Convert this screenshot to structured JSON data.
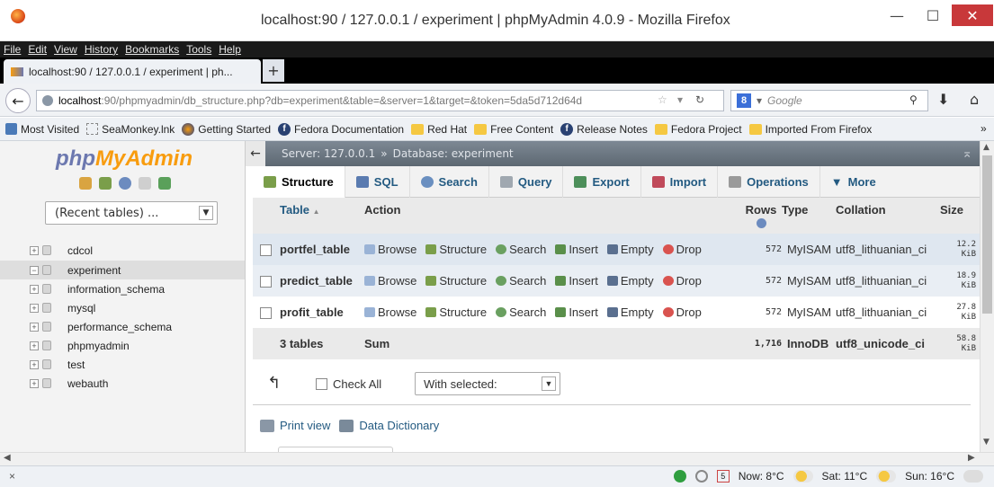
{
  "window": {
    "title": "localhost:90 / 127.0.0.1 / experiment | phpMyAdmin 4.0.9 - Mozilla Firefox"
  },
  "menu": [
    "File",
    "Edit",
    "View",
    "History",
    "Bookmarks",
    "Tools",
    "Help"
  ],
  "tab": {
    "title": "localhost:90 / 127.0.0.1 / experiment | ph...",
    "new_tab": "+"
  },
  "nav": {
    "url_host": "localhost",
    "url_rest": ":90/phpmyadmin/db_structure.php?db=experiment&table=&server=1&target=&token=5da5d712d64d",
    "search_placeholder": "Google",
    "search_engine_icon": "8"
  },
  "bookmarks": [
    "Most Visited",
    "SeaMonkey.lnk",
    "Getting Started",
    "Fedora Documentation",
    "Red Hat",
    "Free Content",
    "Release Notes",
    "Fedora Project",
    "Imported From Firefox"
  ],
  "bookmarks_overflow": "»",
  "sidebar": {
    "logo_a": "php",
    "logo_b": "MyAdmin",
    "recent": "(Recent tables) ...",
    "databases": [
      {
        "name": "cdcol",
        "exp": "+"
      },
      {
        "name": "experiment",
        "exp": "−"
      },
      {
        "name": "information_schema",
        "exp": "+"
      },
      {
        "name": "mysql",
        "exp": "+"
      },
      {
        "name": "performance_schema",
        "exp": "+"
      },
      {
        "name": "phpmyadmin",
        "exp": "+"
      },
      {
        "name": "test",
        "exp": "+"
      },
      {
        "name": "webauth",
        "exp": "+"
      }
    ]
  },
  "breadcrumb": {
    "server": "Server: 127.0.0.1",
    "sep": "»",
    "database": "Database: experiment"
  },
  "tabs": [
    {
      "label": "Structure",
      "color": "#7a9e4a"
    },
    {
      "label": "SQL",
      "color": "#5a7bb0"
    },
    {
      "label": "Search",
      "color": "#6a8fc0"
    },
    {
      "label": "Query",
      "color": "#a0a8b0"
    },
    {
      "label": "Export",
      "color": "#4d8f5a"
    },
    {
      "label": "Import",
      "color": "#c04a5a"
    },
    {
      "label": "Operations",
      "color": "#9a9a9a"
    },
    {
      "label": "More",
      "color": "#555555"
    }
  ],
  "table": {
    "headers": {
      "table": "Table",
      "action": "Action",
      "rows": "Rows",
      "type": "Type",
      "collation": "Collation",
      "size": "Size",
      "sort_arrow": "▲"
    },
    "actions": [
      "Browse",
      "Structure",
      "Search",
      "Insert",
      "Empty",
      "Drop"
    ],
    "rows": [
      {
        "name": "portfel_table",
        "rows": "572",
        "type": "MyISAM",
        "collation": "utf8_lithuanian_ci",
        "size_num": "12.2",
        "size_unit": "KiB"
      },
      {
        "name": "predict_table",
        "rows": "572",
        "type": "MyISAM",
        "collation": "utf8_lithuanian_ci",
        "size_num": "18.9",
        "size_unit": "KiB"
      },
      {
        "name": "profit_table",
        "rows": "572",
        "type": "MyISAM",
        "collation": "utf8_lithuanian_ci",
        "size_num": "27.8",
        "size_unit": "KiB"
      }
    ],
    "total": {
      "name": "3 tables",
      "action": "Sum",
      "rows": "1,716",
      "type": "InnoDB",
      "collation": "utf8_unicode_ci",
      "size_num": "58.8",
      "size_unit": "KiB"
    }
  },
  "footer": {
    "check_all": "Check All",
    "with_selected": "With selected:",
    "print_view": "Print view",
    "data_dictionary": "Data Dictionary"
  },
  "status": {
    "now": "Now: 8°C",
    "sat": "Sat: 11°C",
    "sun": "Sun: 16°C",
    "calendar": "5",
    "close": "×"
  }
}
